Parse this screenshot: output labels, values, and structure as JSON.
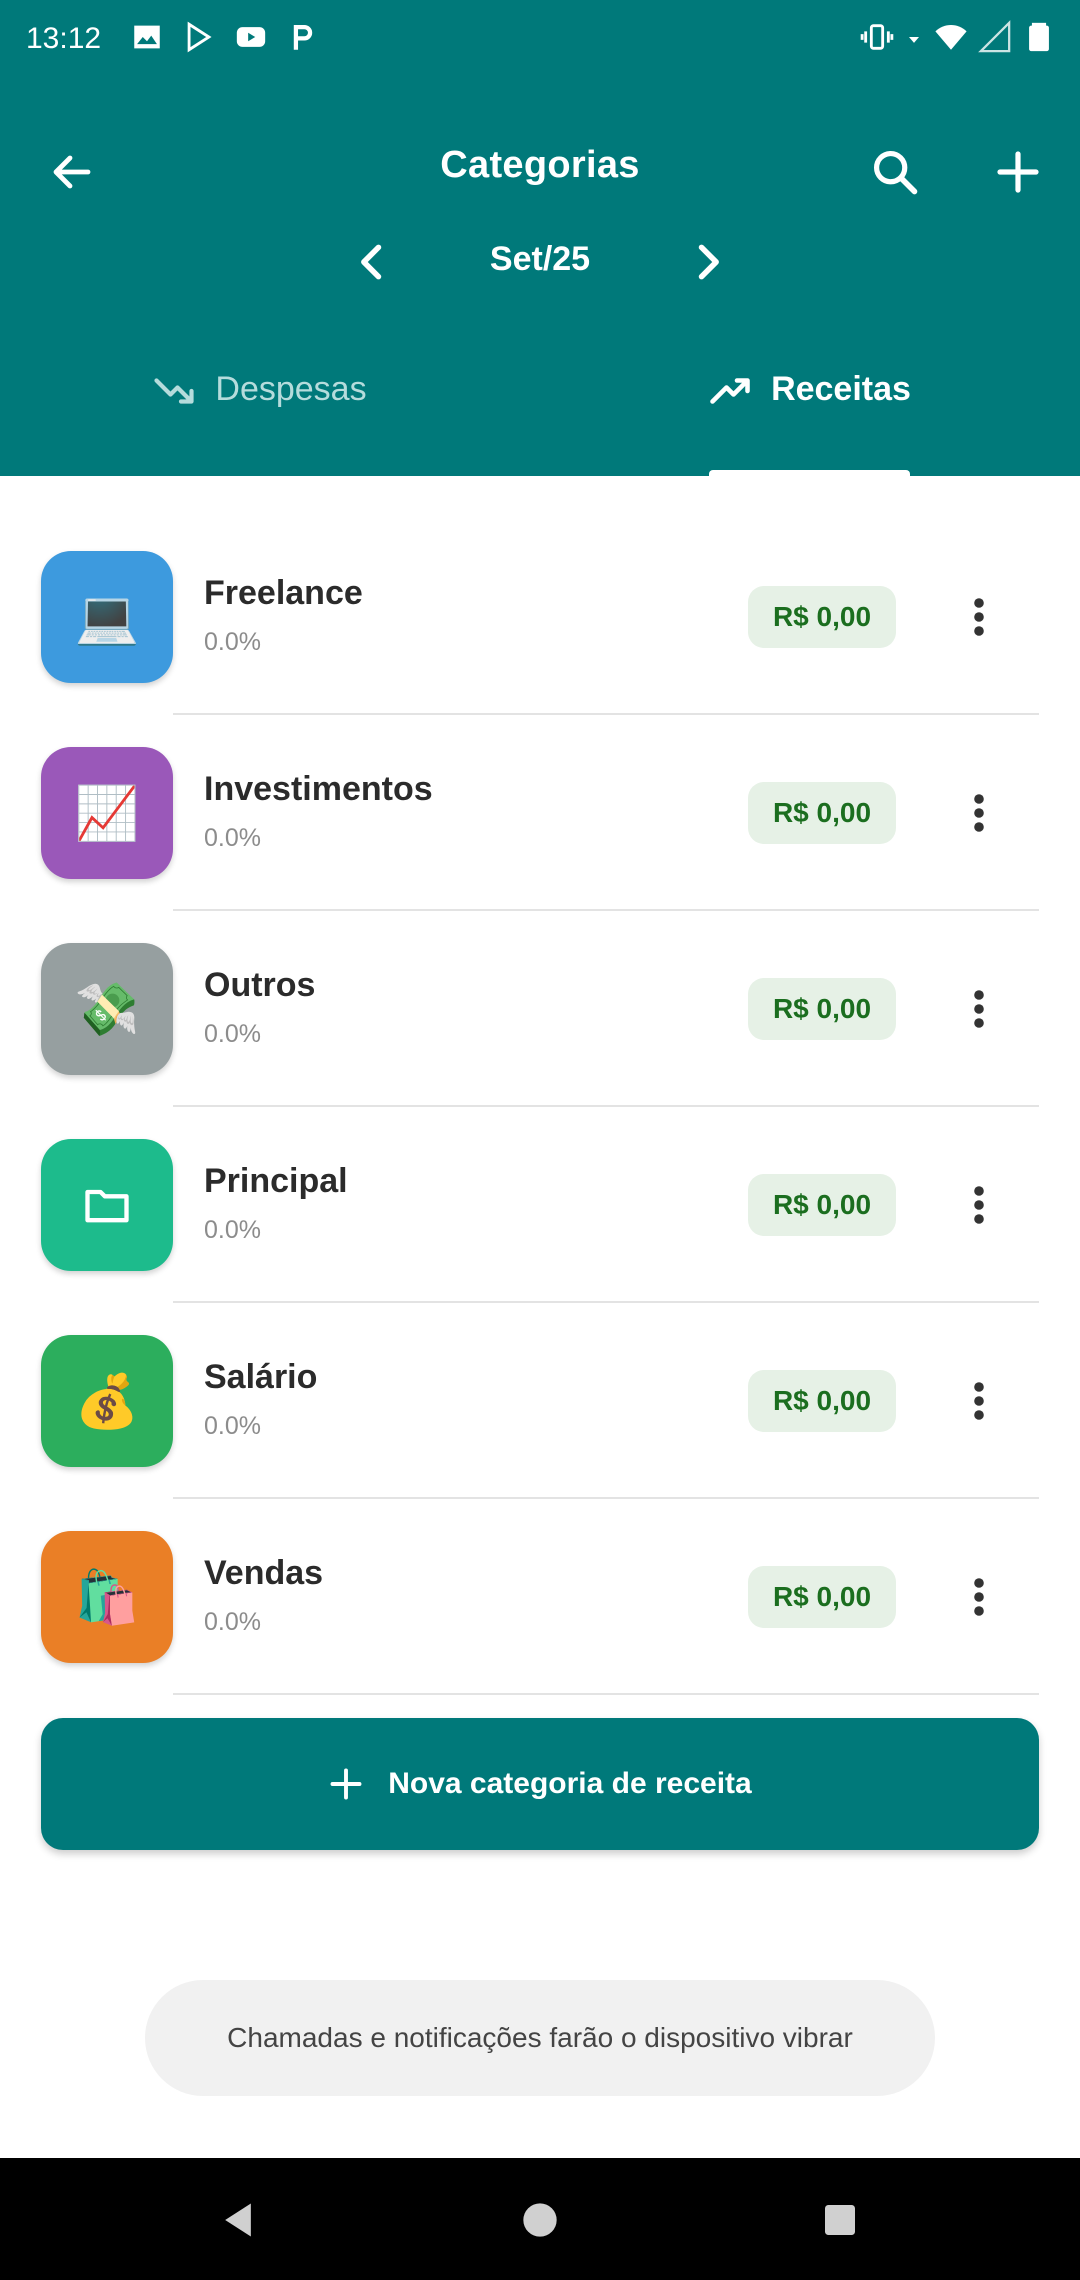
{
  "status_bar": {
    "time": "13:12",
    "left_icons": [
      "image-icon",
      "play-store-icon",
      "youtube-icon",
      "p-app-icon"
    ],
    "right_icons": [
      "vibrate-icon",
      "signal-arrow-icon",
      "wifi-icon",
      "cell-signal-icon",
      "battery-icon"
    ]
  },
  "header": {
    "title": "Categorias",
    "month": "Set/25",
    "background": "#00797a",
    "tabs": [
      {
        "label": "Despesas",
        "icon": "trending-down-icon",
        "selected": false
      },
      {
        "label": "Receitas",
        "icon": "trending-up-icon",
        "selected": true
      }
    ]
  },
  "categories": [
    {
      "name": "Freelance",
      "percent": "0.0%",
      "amount": "R$ 0,00",
      "emoji": "💻",
      "color": "#3d9ade"
    },
    {
      "name": "Investimentos",
      "percent": "0.0%",
      "amount": "R$ 0,00",
      "emoji": "📈",
      "color": "#9a58b9"
    },
    {
      "name": "Outros",
      "percent": "0.0%",
      "amount": "R$ 0,00",
      "emoji": "💸",
      "color": "#969fa0"
    },
    {
      "name": "Principal",
      "percent": "0.0%",
      "amount": "R$ 0,00",
      "emoji": "folder-icon",
      "color": "#1dbb8c"
    },
    {
      "name": "Salário",
      "percent": "0.0%",
      "amount": "R$ 0,00",
      "emoji": "💰",
      "color": "#2cae5d"
    },
    {
      "name": "Vendas",
      "percent": "0.0%",
      "amount": "R$ 0,00",
      "emoji": "🛍️",
      "color": "#ea7f26"
    }
  ],
  "new_category_button": "Nova categoria de receita",
  "toast": "Chamadas e notificações farão o dispositivo vibrar",
  "colors": {
    "primary": "#00797a",
    "amount_bg": "#e6f1e6",
    "amount_text": "#1b6e1f"
  }
}
